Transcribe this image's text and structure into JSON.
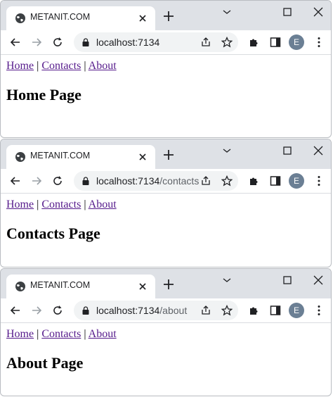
{
  "windows": [
    {
      "tab_title": "METANIT.COM",
      "url_host": "localhost:7134",
      "url_path": "",
      "avatar_letter": "E",
      "nav": {
        "home": "Home",
        "contacts": "Contacts",
        "about": "About",
        "separator": "|"
      },
      "heading": "Home Page"
    },
    {
      "tab_title": "METANIT.COM",
      "url_host": "localhost:7134",
      "url_path": "/contacts",
      "avatar_letter": "E",
      "nav": {
        "home": "Home",
        "contacts": "Contacts",
        "about": "About",
        "separator": "|"
      },
      "heading": "Contacts Page"
    },
    {
      "tab_title": "METANIT.COM",
      "url_host": "localhost:7134",
      "url_path": "/about",
      "avatar_letter": "E",
      "nav": {
        "home": "Home",
        "contacts": "Contacts",
        "about": "About",
        "separator": "|"
      },
      "heading": "About Page"
    }
  ],
  "colors": {
    "tabbar": "#dee1e6",
    "link_visited": "#551a8b",
    "avatar_bg": "#6b7f94",
    "omnibox_bg": "#f1f3f4"
  },
  "icons": [
    "globe-icon",
    "close-icon",
    "plus-icon",
    "minimize-icon",
    "maximize-icon",
    "window-close-icon",
    "back-arrow-icon",
    "forward-arrow-icon",
    "reload-icon",
    "lock-icon",
    "share-icon",
    "star-icon",
    "puzzle-extension-icon",
    "side-panel-icon",
    "kebab-menu-icon"
  ]
}
